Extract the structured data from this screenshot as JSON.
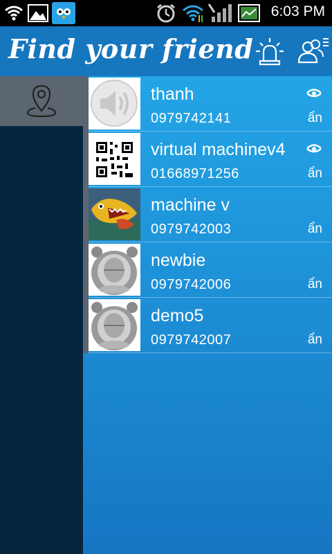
{
  "status_bar": {
    "time": "6:03 PM",
    "icons": [
      "wifi-icon",
      "image-notification-icon",
      "bird-app-icon",
      "alarm-icon",
      "wifi-data-icon",
      "signal-icon",
      "battery-icon"
    ]
  },
  "app_bar": {
    "title": "Find your friend",
    "actions": [
      "siren-alert-icon",
      "contacts-icon"
    ]
  },
  "sidebar": {
    "items": [
      {
        "icon": "location-pin-icon",
        "selected": true
      }
    ]
  },
  "friends": [
    {
      "name": "thanh",
      "phone": "0979742141",
      "status": "ẩn",
      "avatar": "speaker-icon",
      "show_eye": true
    },
    {
      "name": "virtual machinev4",
      "phone": "01668971256",
      "status": "ẩn",
      "avatar": "qr-code-icon",
      "show_eye": true
    },
    {
      "name": "machine v",
      "phone": "0979742003",
      "status": "ẩn",
      "avatar": "fish-painting",
      "show_eye": false
    },
    {
      "name": "newbie",
      "phone": "0979742006",
      "status": "ẩn",
      "avatar": "robot-avatar",
      "show_eye": false
    },
    {
      "name": "demo5",
      "phone": "0979742007",
      "status": "ẩn",
      "avatar": "robot-avatar",
      "show_eye": false
    }
  ],
  "colors": {
    "app_bar": "#1676be",
    "list_top": "#23a5e6",
    "list_bottom": "#1676c4",
    "sidebar": "#062640",
    "selected": "#5c6670"
  }
}
